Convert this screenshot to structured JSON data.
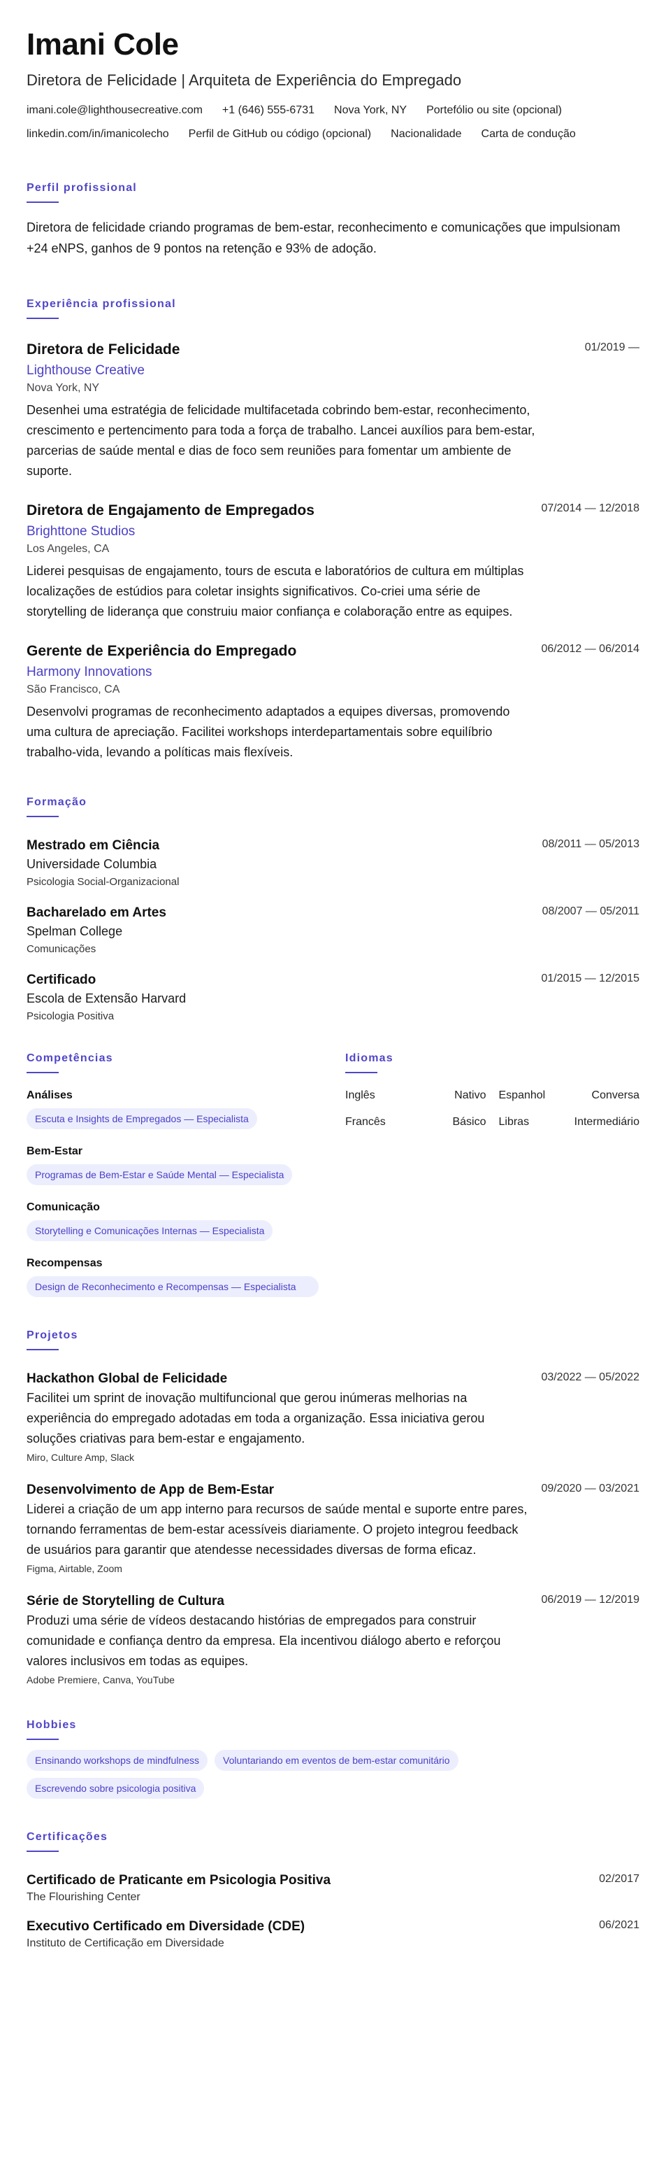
{
  "header": {
    "name": "Imani Cole",
    "headline": "Diretora de Felicidade | Arquiteta de Experiência do Empregado",
    "contacts": [
      "imani.cole@lighthousecreative.com",
      "+1 (646) 555-6731",
      "Nova York, NY",
      "Portefólio ou site (opcional)",
      "linkedin.com/in/imanicolecho",
      "Perfil de GitHub ou código (opcional)",
      "Nacionalidade",
      "Carta de condução"
    ]
  },
  "summary": {
    "title": "Perfil profissional",
    "text": "Diretora de felicidade criando programas de bem-estar, reconhecimento e comunicações que impulsionam +24 eNPS, ganhos de 9 pontos na retenção e 93% de adoção."
  },
  "experience": {
    "title": "Experiência profissional",
    "items": [
      {
        "role": "Diretora de Felicidade",
        "date": "01/2019 —",
        "company": "Lighthouse Creative",
        "location": "Nova York, NY",
        "description": "Desenhei uma estratégia de felicidade multifacetada cobrindo bem-estar, reconhecimento, crescimento e pertencimento para toda a força de trabalho. Lancei auxílios para bem-estar, parcerias de saúde mental e dias de foco sem reuniões para fomentar um ambiente de suporte."
      },
      {
        "role": "Diretora de Engajamento de Empregados",
        "date": "07/2014 — 12/2018",
        "company": "Brighttone Studios",
        "location": "Los Angeles, CA",
        "description": "Liderei pesquisas de engajamento, tours de escuta e laboratórios de cultura em múltiplas localizações de estúdios para coletar insights significativos. Co-criei uma série de storytelling de liderança que construiu maior confiança e colaboração entre as equipes."
      },
      {
        "role": "Gerente de Experiência do Empregado",
        "date": "06/2012 — 06/2014",
        "company": "Harmony Innovations",
        "location": "São Francisco, CA",
        "description": "Desenvolvi programas de reconhecimento adaptados a equipes diversas, promovendo uma cultura de apreciação. Facilitei workshops interdepartamentais sobre equilíbrio trabalho-vida, levando a políticas mais flexíveis."
      }
    ]
  },
  "education": {
    "title": "Formação",
    "items": [
      {
        "degree": "Mestrado em Ciência",
        "date": "08/2011 — 05/2013",
        "school": "Universidade Columbia",
        "field": "Psicologia Social-Organizacional"
      },
      {
        "degree": "Bacharelado em Artes",
        "date": "08/2007 — 05/2011",
        "school": "Spelman College",
        "field": "Comunicações"
      },
      {
        "degree": "Certificado",
        "date": "01/2015 — 12/2015",
        "school": "Escola de Extensão Harvard",
        "field": "Psicologia Positiva"
      }
    ]
  },
  "skills": {
    "title": "Competências",
    "groups": [
      {
        "category": "Análises",
        "skill": "Escuta e Insights de Empregados — Especialista"
      },
      {
        "category": "Bem-Estar",
        "skill": "Programas de Bem-Estar e Saúde Mental — Especialista"
      },
      {
        "category": "Comunicação",
        "skill": "Storytelling e Comunicações Internas — Especialista"
      },
      {
        "category": "Recompensas",
        "skill": "Design de Reconhecimento e Recompensas — Especialista"
      }
    ]
  },
  "languages": {
    "title": "Idiomas",
    "items": [
      {
        "language": "Inglês",
        "level": "Nativo"
      },
      {
        "language": "Espanhol",
        "level": "Conversa"
      },
      {
        "language": "Francês",
        "level": "Básico"
      },
      {
        "language": "Libras",
        "level": "Intermediário"
      }
    ]
  },
  "projects": {
    "title": "Projetos",
    "items": [
      {
        "name": "Hackathon Global de Felicidade",
        "date": "03/2022 — 05/2022",
        "description": "Facilitei um sprint de inovação multifuncional que gerou inúmeras melhorias na experiência do empregado adotadas em toda a organização. Essa iniciativa gerou soluções criativas para bem-estar e engajamento.",
        "tools": "Miro, Culture Amp, Slack"
      },
      {
        "name": "Desenvolvimento de App de Bem-Estar",
        "date": "09/2020 — 03/2021",
        "description": "Liderei a criação de um app interno para recursos de saúde mental e suporte entre pares, tornando ferramentas de bem-estar acessíveis diariamente. O projeto integrou feedback de usuários para garantir que atendesse necessidades diversas de forma eficaz.",
        "tools": "Figma, Airtable, Zoom"
      },
      {
        "name": "Série de Storytelling de Cultura",
        "date": "06/2019 — 12/2019",
        "description": "Produzi uma série de vídeos destacando histórias de empregados para construir comunidade e confiança dentro da empresa. Ela incentivou diálogo aberto e reforçou valores inclusivos em todas as equipes.",
        "tools": "Adobe Premiere, Canva, YouTube"
      }
    ]
  },
  "hobbies": {
    "title": "Hobbies",
    "items": [
      "Ensinando workshops de mindfulness",
      "Voluntariando em eventos de bem-estar comunitário",
      "Escrevendo sobre psicologia positiva"
    ]
  },
  "certifications": {
    "title": "Certificações",
    "items": [
      {
        "name": "Certificado de Praticante em Psicologia Positiva",
        "date": "02/2017",
        "issuer": "The Flourishing Center"
      },
      {
        "name": "Executivo Certificado em Diversidade (CDE)",
        "date": "06/2021",
        "issuer": "Instituto de Certificação em Diversidade"
      }
    ]
  },
  "colors": {
    "accent": "#5046c8",
    "chip_bg": "#eceefd",
    "chip_text": "#4b40c8"
  }
}
